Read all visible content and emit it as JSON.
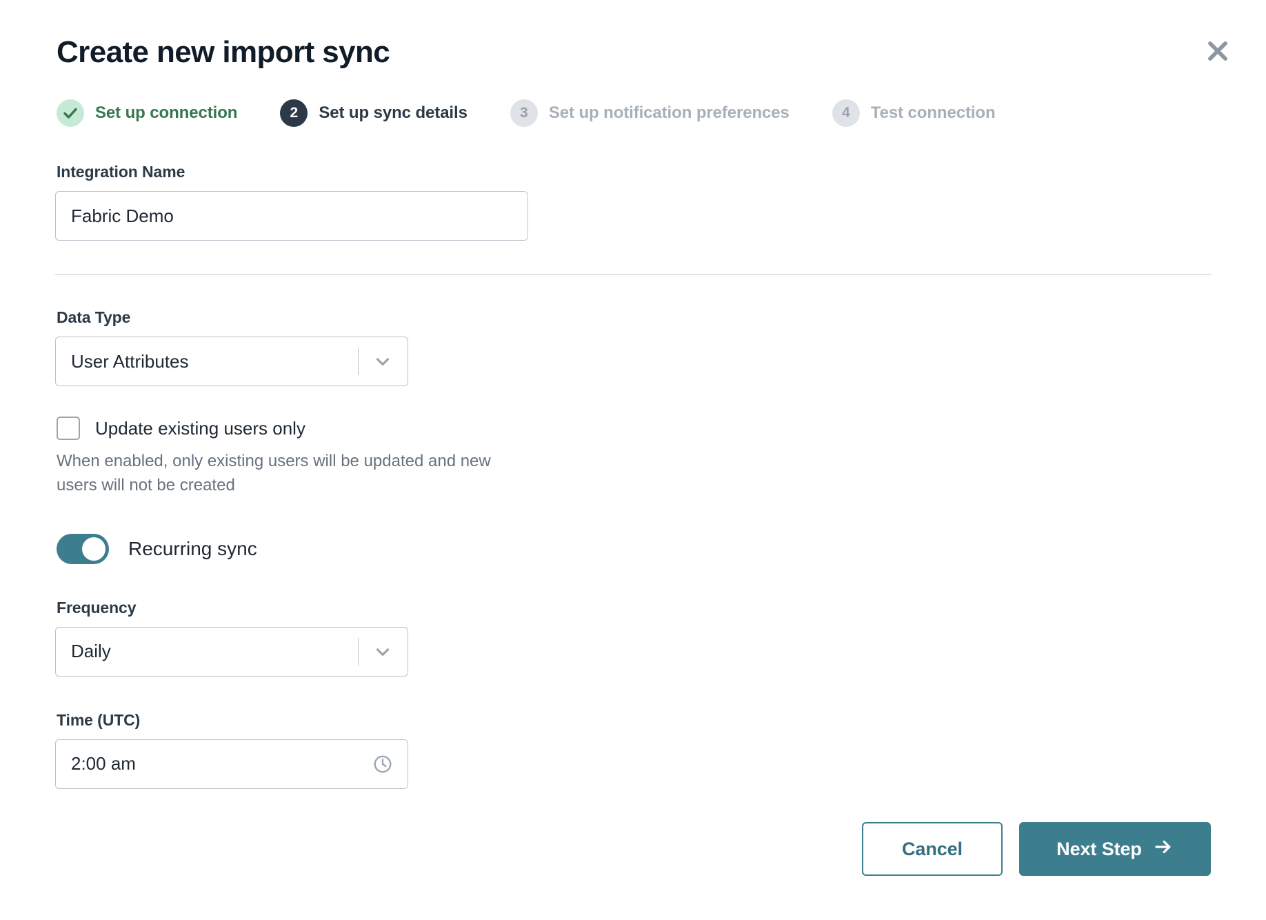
{
  "modal": {
    "title": "Create new import sync",
    "close_icon": "close-icon"
  },
  "stepper": {
    "steps": [
      {
        "badge": "✓",
        "label": "Set up connection",
        "state": "done"
      },
      {
        "badge": "2",
        "label": "Set up sync details",
        "state": "current"
      },
      {
        "badge": "3",
        "label": "Set up notification preferences",
        "state": "todo"
      },
      {
        "badge": "4",
        "label": "Test connection",
        "state": "todo"
      }
    ]
  },
  "form": {
    "integration_name": {
      "label": "Integration Name",
      "value": "Fabric Demo",
      "placeholder": "Integration Name"
    },
    "data_type": {
      "label": "Data Type",
      "value": "User Attributes",
      "chevron_icon": "chevron-down-icon"
    },
    "update_existing": {
      "label": "Update existing users only",
      "checked": false,
      "help": "When enabled, only existing users will be updated and new users will not be created"
    },
    "recurring_sync": {
      "label": "Recurring sync",
      "enabled": true
    },
    "frequency": {
      "label": "Frequency",
      "value": "Daily",
      "chevron_icon": "chevron-down-icon"
    },
    "time_utc": {
      "label": "Time (UTC)",
      "value": "2:00 am",
      "clock_icon": "clock-icon"
    }
  },
  "footer": {
    "cancel_label": "Cancel",
    "next_label": "Next Step",
    "next_icon": "arrow-right-icon"
  },
  "colors": {
    "accent_teal": "#3d7e8e",
    "success_green": "#35774f",
    "success_bg": "#c7ead6",
    "current_dark": "#2c3a47",
    "muted_gray": "#a7b0b9",
    "border": "#b9c2cb"
  }
}
